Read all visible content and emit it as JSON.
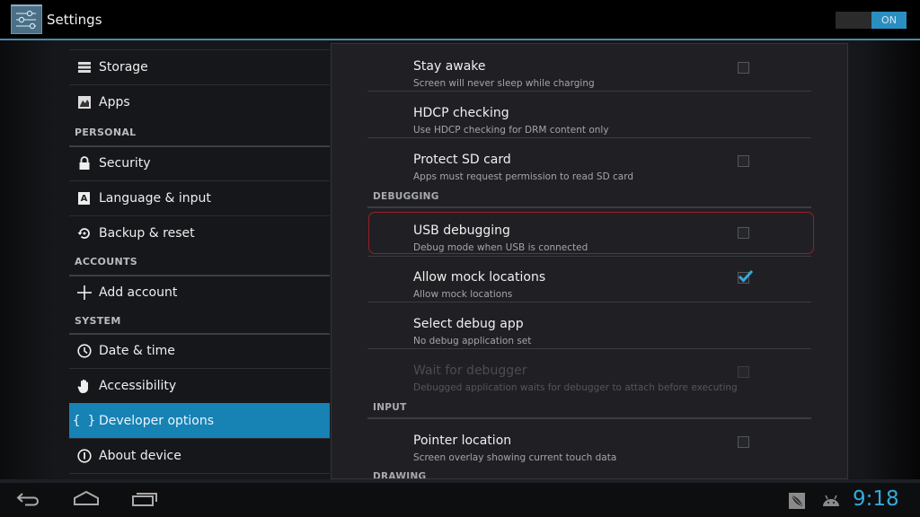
{
  "actionbar": {
    "title": "Settings",
    "app_icon": "settings-sliders-icon",
    "master_toggle": {
      "label": "ON",
      "state": "on"
    }
  },
  "nav": {
    "items": [
      {
        "label": "Storage",
        "icon": "storage-icon",
        "selected": false
      },
      {
        "label": "Apps",
        "icon": "apps-icon",
        "selected": false
      },
      {
        "header": "PERSONAL"
      },
      {
        "label": "Security",
        "icon": "lock-icon",
        "selected": false
      },
      {
        "label": "Language & input",
        "icon": "language-icon",
        "selected": false
      },
      {
        "label": "Backup & reset",
        "icon": "backup-icon",
        "selected": false
      },
      {
        "header": "ACCOUNTS"
      },
      {
        "label": "Add account",
        "icon": "plus-icon",
        "selected": false
      },
      {
        "header": "SYSTEM"
      },
      {
        "label": "Date & time",
        "icon": "clock-icon",
        "selected": false
      },
      {
        "label": "Accessibility",
        "icon": "hand-icon",
        "selected": false
      },
      {
        "label": "Developer options",
        "icon": "braces-icon",
        "selected": true
      },
      {
        "label": "About device",
        "icon": "info-icon",
        "selected": false
      }
    ]
  },
  "panel": {
    "prefs": [
      {
        "title": "Stay awake",
        "summary": "Screen will never sleep while charging",
        "checkbox": "unchecked",
        "enabled": true
      },
      {
        "title": "HDCP checking",
        "summary": "Use HDCP checking for DRM content only",
        "checkbox": null,
        "enabled": true
      },
      {
        "title": "Protect SD card",
        "summary": "Apps must request permission to read SD card",
        "checkbox": "unchecked",
        "enabled": true
      },
      {
        "category": "DEBUGGING"
      },
      {
        "title": "USB debugging",
        "summary": "Debug mode when USB is connected",
        "checkbox": "unchecked",
        "enabled": true,
        "highlighted": true
      },
      {
        "title": "Allow mock locations",
        "summary": "Allow mock locations",
        "checkbox": "checked",
        "enabled": true
      },
      {
        "title": "Select debug app",
        "summary": "No debug application set",
        "checkbox": null,
        "enabled": true
      },
      {
        "title": "Wait for debugger",
        "summary": "Debugged application waits for debugger to attach before executing",
        "checkbox": "unchecked",
        "enabled": false
      },
      {
        "category": "INPUT"
      },
      {
        "title": "Pointer location",
        "summary": "Screen overlay showing current touch data",
        "checkbox": "unchecked",
        "enabled": true
      },
      {
        "category": "DRAWING"
      }
    ],
    "highlight_color": "#9a1d28",
    "check_color": "#35a9dc"
  },
  "sysbar": {
    "buttons": [
      "back-icon",
      "home-icon",
      "recents-icon"
    ],
    "notifications": [
      "feather-notification-icon",
      "android-debug-icon"
    ],
    "time": "9:18"
  }
}
